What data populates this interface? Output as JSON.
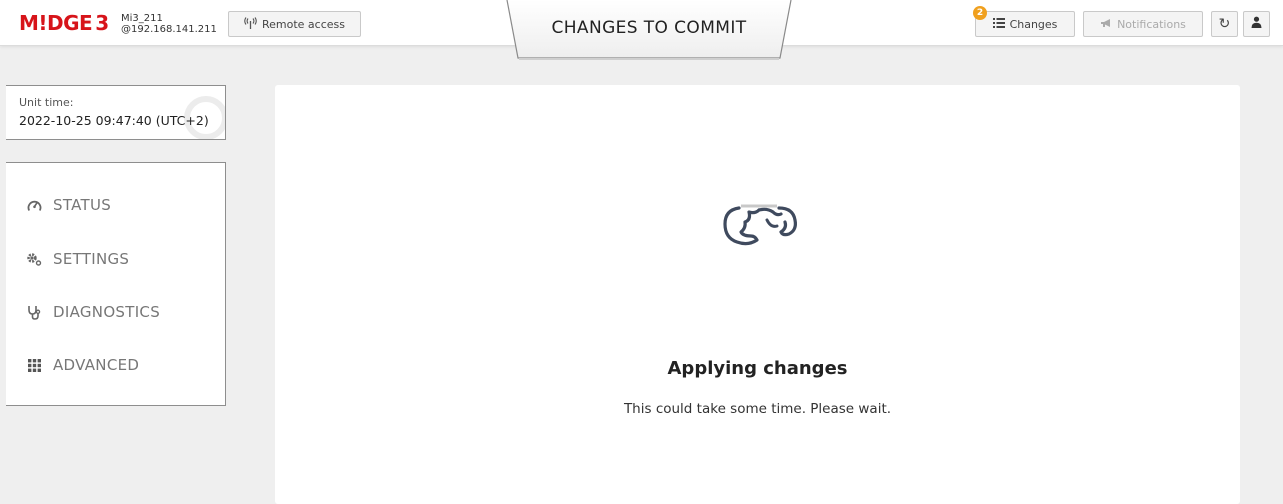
{
  "header": {
    "logo": {
      "brand": "M!DGE",
      "number": "3"
    },
    "device": {
      "name": "Mi3_211",
      "address": "@192.168.141.211"
    },
    "remote_access": {
      "label": "Remote access",
      "icon": "antenna-icon"
    },
    "commit_tab": {
      "label": "CHANGES TO COMMIT"
    },
    "changes": {
      "label": "Changes",
      "icon": "list-icon",
      "badge": "2"
    },
    "notifications": {
      "label": "Notifications",
      "icon": "megaphone-icon"
    },
    "refresh": {
      "icon": "refresh-icon",
      "glyph": "↻"
    },
    "user": {
      "icon": "user-icon",
      "glyph": "👤"
    }
  },
  "unit_time": {
    "label": "Unit time:",
    "value": "2022-10-25 09:47:40 (UTC+2)"
  },
  "nav": {
    "items": [
      {
        "label": "STATUS",
        "icon": "gauge-icon"
      },
      {
        "label": "SETTINGS",
        "icon": "gears-icon"
      },
      {
        "label": "DIAGNOSTICS",
        "icon": "stethoscope-icon"
      },
      {
        "label": "ADVANCED",
        "icon": "grid-icon"
      }
    ]
  },
  "main": {
    "title": "Applying changes",
    "subtitle": "This could take some time. Please wait.",
    "icon": "loading-hand-icon"
  },
  "colors": {
    "brand": "#d7141a",
    "badge": "#f0a01e",
    "background": "#efefef",
    "icon_stroke": "#3f4a5e"
  }
}
